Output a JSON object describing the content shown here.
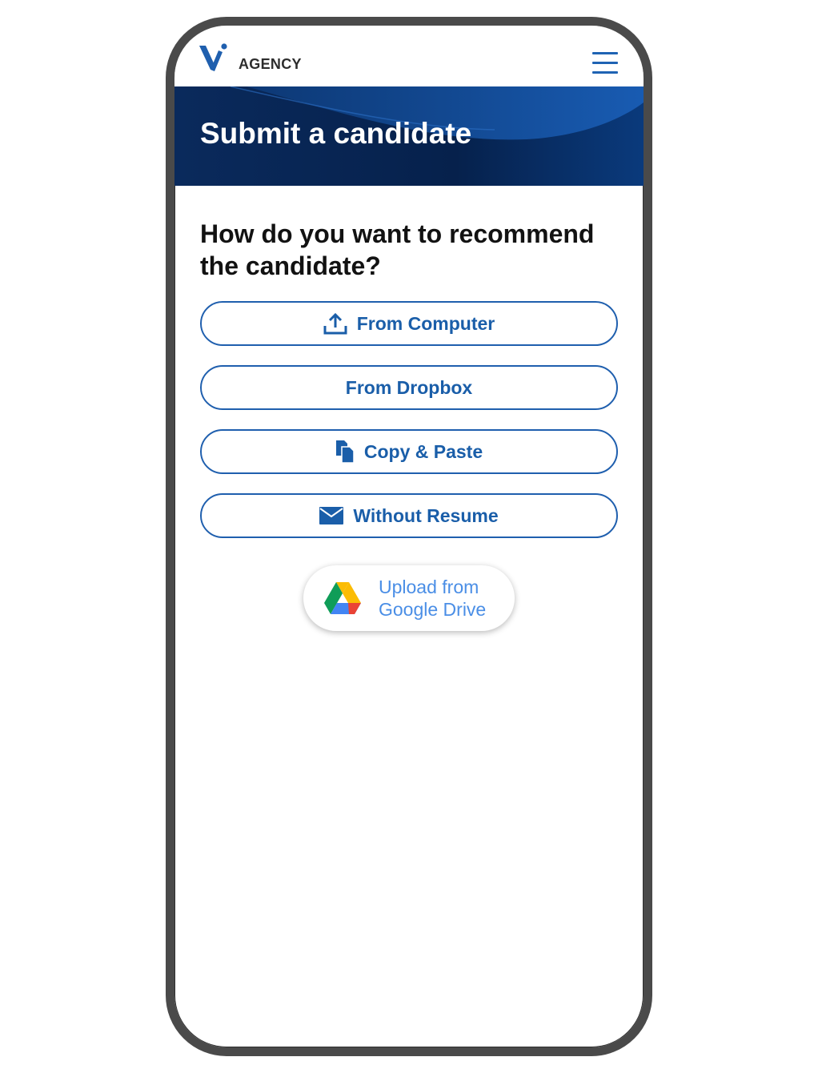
{
  "header": {
    "brand": "AGENCY",
    "logo_icon": "v-logo-icon",
    "menu_icon": "hamburger-menu-icon"
  },
  "hero": {
    "title": "Submit a candidate"
  },
  "main": {
    "question": "How do you want to recommend the candidate?",
    "options": [
      {
        "label": "From Computer",
        "icon": "upload-icon"
      },
      {
        "label": "From Dropbox",
        "icon": ""
      },
      {
        "label": "Copy & Paste",
        "icon": "copy-documents-icon"
      },
      {
        "label": "Without Resume",
        "icon": "envelope-icon"
      }
    ],
    "google_drive": {
      "line1": "Upload from",
      "line2": "Google Drive",
      "icon": "google-drive-icon"
    }
  },
  "colors": {
    "accent": "#1f5fae",
    "hero_bg": "#06214c",
    "drive_text": "#4a8ee6",
    "frame": "#4a4a4a"
  }
}
